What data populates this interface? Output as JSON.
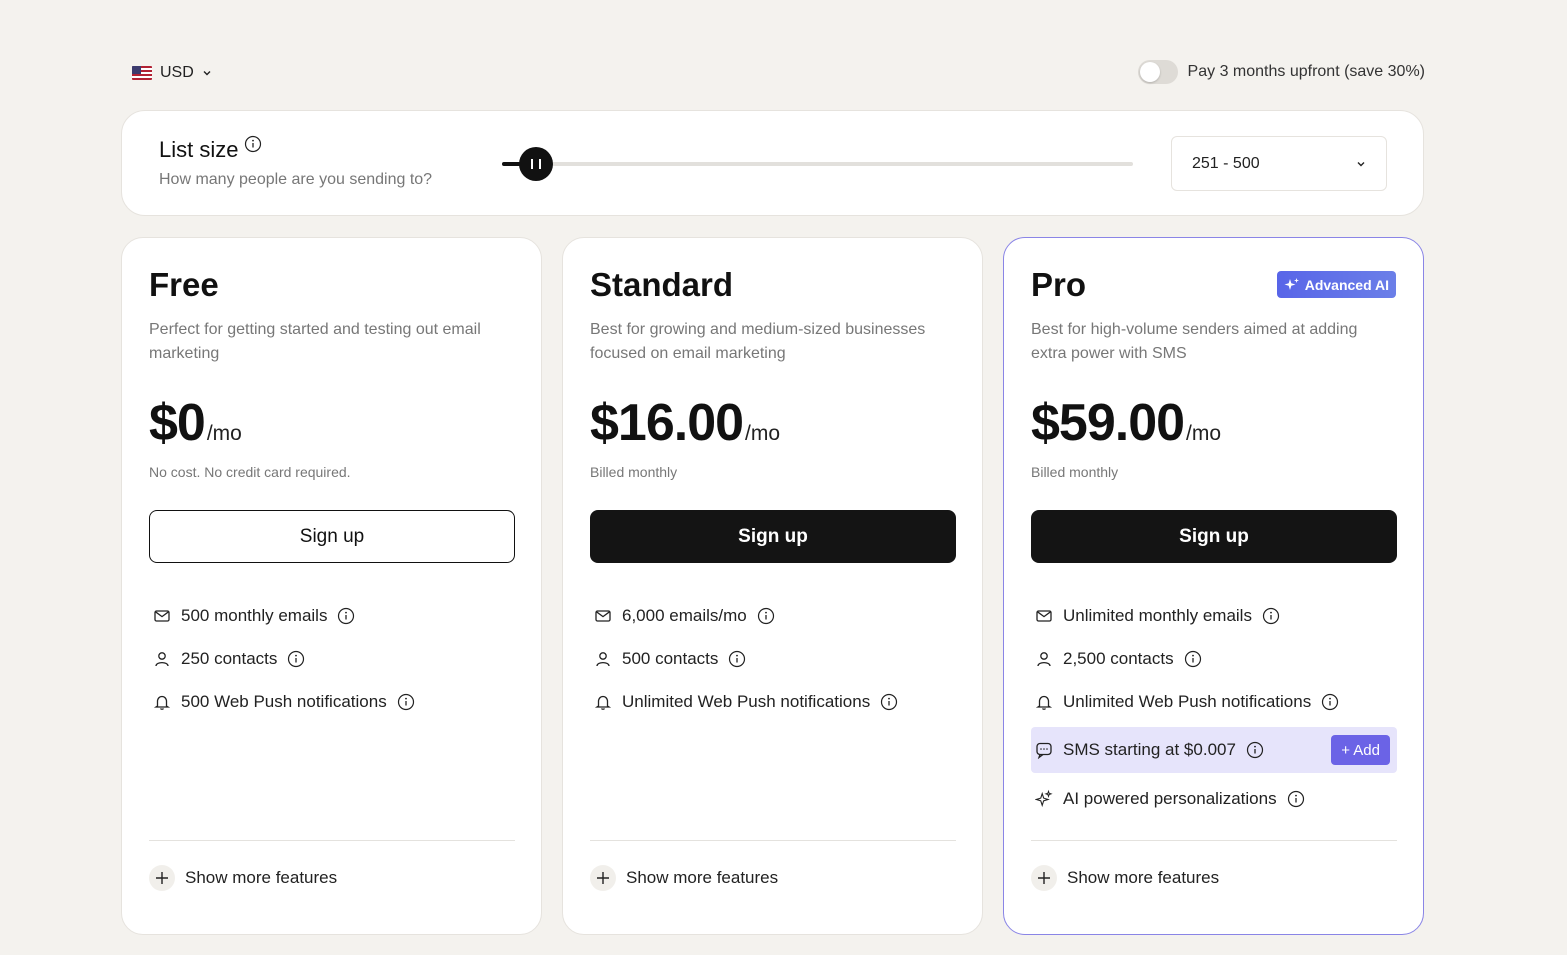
{
  "currency": {
    "label": "USD",
    "flag": "us-flag-icon"
  },
  "upfront": {
    "label": "Pay 3 months upfront (save 30%)",
    "enabled": false
  },
  "list_size": {
    "title": "List size",
    "subtitle": "How many people are you sending to?",
    "selected": "251 - 500",
    "slider_level": 0.04
  },
  "plans": [
    {
      "name": "Free",
      "description": "Perfect for getting started and testing out email marketing",
      "price": "$0",
      "per": "/mo",
      "billing": "No cost. No credit card required.",
      "cta": "Sign up",
      "features": [
        "500 monthly emails",
        "250 contacts",
        "500 Web Push notifications"
      ],
      "more": "Show more features"
    },
    {
      "name": "Standard",
      "description": "Best for growing and medium-sized businesses focused on email marketing",
      "price": "$16.00",
      "per": "/mo",
      "billing": "Billed monthly",
      "cta": "Sign up",
      "features": [
        "6,000 emails/mo",
        "500 contacts",
        "Unlimited Web Push notifications"
      ],
      "more": "Show more features"
    },
    {
      "name": "Pro",
      "badge": "Advanced AI",
      "description": "Best for high-volume senders aimed at adding extra power with SMS",
      "price": "$59.00",
      "per": "/mo",
      "billing": "Billed monthly",
      "cta": "Sign up",
      "features": [
        "Unlimited monthly emails",
        "2,500 contacts",
        "Unlimited Web Push notifications",
        "SMS starting at $0.007",
        "AI powered personalizations"
      ],
      "sms_add": "+ Add",
      "more": "Show more features"
    }
  ],
  "colors": {
    "accent": "#6b63e6",
    "pro_border": "#8a85e6",
    "background": "#f4f2ee"
  }
}
